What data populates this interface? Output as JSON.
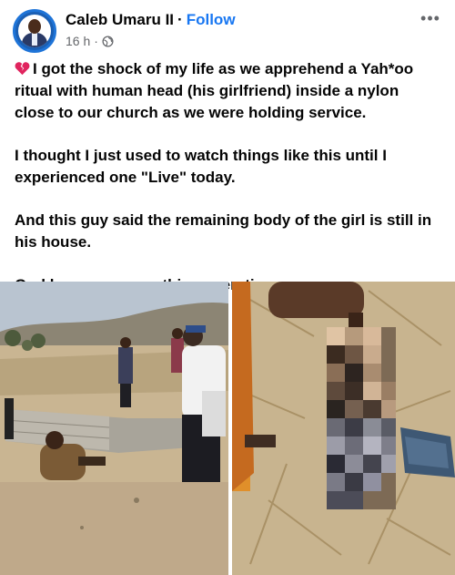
{
  "author": {
    "name": "Caleb Umaru II",
    "separator": "·",
    "follow_label": "Follow",
    "timestamp": "16 h",
    "meta_separator": "·",
    "privacy_icon": "globe-icon",
    "avatar_icon": "profile-photo"
  },
  "header": {
    "more_icon": "more-options-icon",
    "more_label": "•••"
  },
  "post": {
    "emoji_icon": "broken-heart-icon",
    "paragraphs": [
      "I got the shock of my life as we apprehend a Yah*oo ritual with human head (his girlfriend) inside a nylon close to our church as we were holding service.",
      "I thought I just used to watch things like this until I experienced one \"Live\" today.",
      "And this guy said the remaining body of the girl is still in his house.",
      "God have mercy on this generation."
    ]
  },
  "media": {
    "images": [
      {
        "id": "photo-1",
        "subject": "people gathered near a low block wall on a dry hillside"
      },
      {
        "id": "photo-2",
        "subject": "blurred object held above dry grass"
      }
    ]
  },
  "colors": {
    "link": "#1877f2",
    "meta": "#65676b",
    "text": "#050505",
    "heart": "#e0245e"
  }
}
